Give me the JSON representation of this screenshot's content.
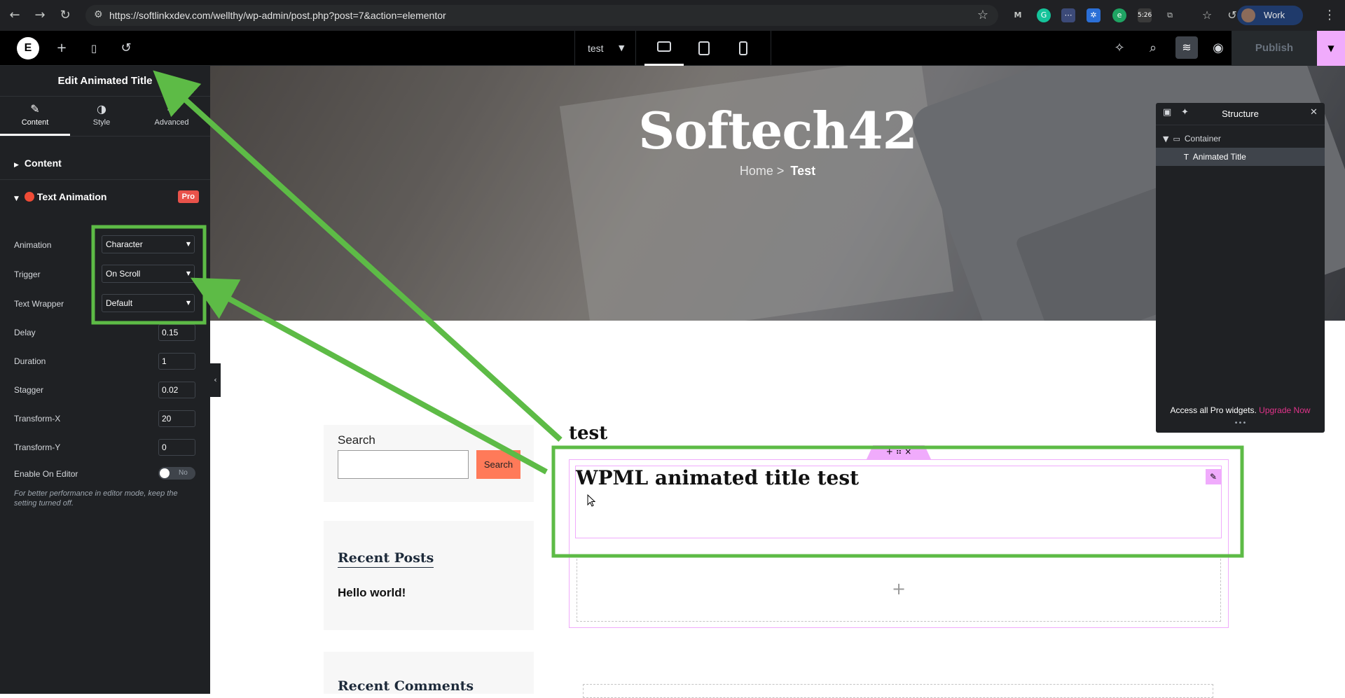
{
  "browser": {
    "url": "https://softlinkxdev.com/wellthy/wp-admin/post.php?post=7&action=elementor",
    "profile_label": "Work",
    "badge_time": "5:26"
  },
  "topbar": {
    "page_name": "test",
    "publish_label": "Publish"
  },
  "panel": {
    "title": "Edit Animated Title",
    "tabs": [
      {
        "label": "Content",
        "icon": "pencil-icon"
      },
      {
        "label": "Style",
        "icon": "half-circle-icon"
      },
      {
        "label": "Advanced",
        "icon": "gear-icon"
      }
    ],
    "sections": {
      "content": "Content",
      "text_animation": "Text Animation",
      "pro_badge": "Pro"
    },
    "controls": {
      "animation": {
        "label": "Animation",
        "value": "Character"
      },
      "trigger": {
        "label": "Trigger",
        "value": "On Scroll"
      },
      "text_wrapper": {
        "label": "Text Wrapper",
        "value": "Default"
      },
      "delay": {
        "label": "Delay",
        "value": "0.15"
      },
      "duration": {
        "label": "Duration",
        "value": "1"
      },
      "stagger": {
        "label": "Stagger",
        "value": "0.02"
      },
      "transform_x": {
        "label": "Transform-X",
        "value": "20"
      },
      "transform_y": {
        "label": "Transform-Y",
        "value": "0"
      },
      "enable_on_editor": {
        "label": "Enable On Editor",
        "value": "No"
      }
    },
    "note": "For better performance in editor mode, keep the setting turned off."
  },
  "canvas": {
    "site_title": "Softech42",
    "breadcrumb_home": "Home >",
    "breadcrumb_current": "Test",
    "search_label": "Search",
    "search_button": "Search",
    "recent_posts_heading": "Recent Posts",
    "recent_post_item": "Hello world!",
    "recent_comments_heading": "Recent Comments",
    "post_title": "test",
    "widget_title": "WPML animated title test",
    "add_symbol": "+"
  },
  "structure": {
    "title": "Structure",
    "items": [
      {
        "label": "Container"
      },
      {
        "label": "Animated Title"
      }
    ],
    "footer_text": "Access all Pro widgets.",
    "upgrade_link": "Upgrade Now"
  },
  "colors": {
    "annotation_green": "#5dbb46",
    "elementor_pink": "#f0abfc",
    "panel_bg": "#1f2124",
    "search_button": "#ff7a59",
    "upgrade_link": "#e0338a"
  }
}
